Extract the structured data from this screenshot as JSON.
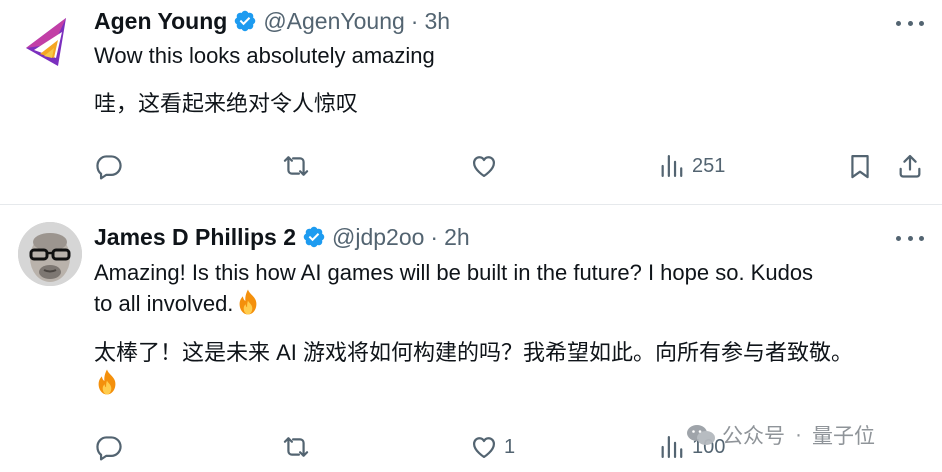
{
  "tweets": [
    {
      "author_name": "Agen Young",
      "handle": "@AgenYoung",
      "separator": "·",
      "time": "3h",
      "lines": [
        "Wow this looks absolutely amazing",
        "哇，这看起来绝对令人惊叹"
      ],
      "views": "251",
      "likes": "",
      "replies": "",
      "retweets": ""
    },
    {
      "author_name": "James D Phillips 2",
      "handle": "@jdp2oo",
      "separator": "·",
      "time": "2h",
      "lines": [
        "Amazing!  Is this how AI games will be built in the future? I hope so. Kudos",
        "to all involved.",
        "太棒了！这是未来 AI 游戏将如何构建的吗？我希望如此。向所有参与者致敬。"
      ],
      "views": "100",
      "likes": "1",
      "replies": "",
      "retweets": ""
    }
  ],
  "watermark": {
    "left": "公众号",
    "separator": "·",
    "right": "量子位"
  },
  "icons": {
    "verified": "verified-badge-icon",
    "more": "more-icon",
    "reply": "reply-icon",
    "retweet": "retweet-icon",
    "like": "heart-icon",
    "views": "views-icon",
    "bookmark": "bookmark-icon",
    "share": "share-icon",
    "emoji": "fire-emoji-icon"
  },
  "colors": {
    "verified_blue": "#1d9bf0",
    "text_primary": "#0f1419",
    "text_secondary": "#536471",
    "divider": "#e6e9ec"
  }
}
